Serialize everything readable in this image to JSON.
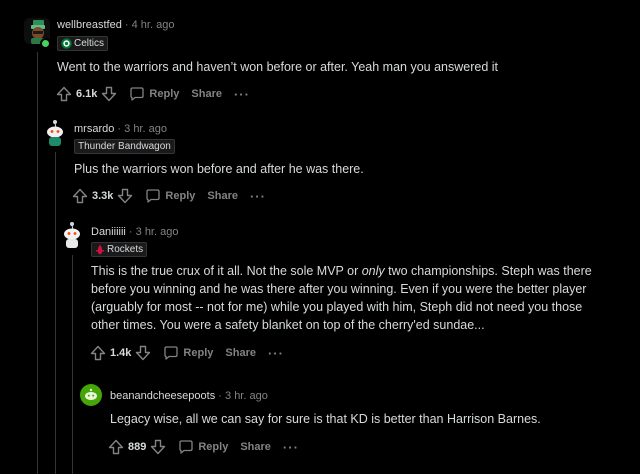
{
  "comments": [
    {
      "username": "wellbreastfed",
      "time": "4 hr. ago",
      "flair": "Celtics",
      "body": "Went to the warriors and haven’t won before or after. Yeah man you answered it",
      "score": "6.1k",
      "reply_label": "Reply",
      "share_label": "Share",
      "more_label": "···"
    },
    {
      "username": "mrsardo",
      "time": "3 hr. ago",
      "flair": "Thunder Bandwagon",
      "body": "Plus the warriors won before and after he was there.",
      "score": "3.3k",
      "reply_label": "Reply",
      "share_label": "Share",
      "more_label": "···"
    },
    {
      "username": "Daniiiiii",
      "time": "3 hr. ago",
      "flair": "Rockets",
      "body_before": "This is the true crux of it all. Not the sole MVP or ",
      "body_italic": "only",
      "body_after": " two championships. Steph was there before you winning and he was there after you winning. Even if you were the better player (arguably for most -- not for me) while you played with him, Steph did not need you those other times. You were a safety blanket on top of the cherry'ed sundae...",
      "score": "1.4k",
      "reply_label": "Reply",
      "share_label": "Share",
      "more_label": "···"
    },
    {
      "username": "beanandcheesepoots",
      "time": "3 hr. ago",
      "body": "Legacy wise, all we can say for sure is that KD is better than Harrison Barnes.",
      "score": "889",
      "reply_label": "Reply",
      "share_label": "Share",
      "more_label": "···"
    }
  ],
  "separator": "·",
  "colors": {
    "background": "#000000",
    "text": "#d7dadc",
    "muted": "#818384",
    "celtics_green": "#007a33",
    "rockets_red": "#ce1141",
    "avatar_green": "#46a508",
    "online_green": "#46d160"
  },
  "icons": [
    "upvote-icon",
    "downvote-icon",
    "comment-icon",
    "more-icon",
    "celtics-logo-icon",
    "rockets-logo-icon"
  ]
}
